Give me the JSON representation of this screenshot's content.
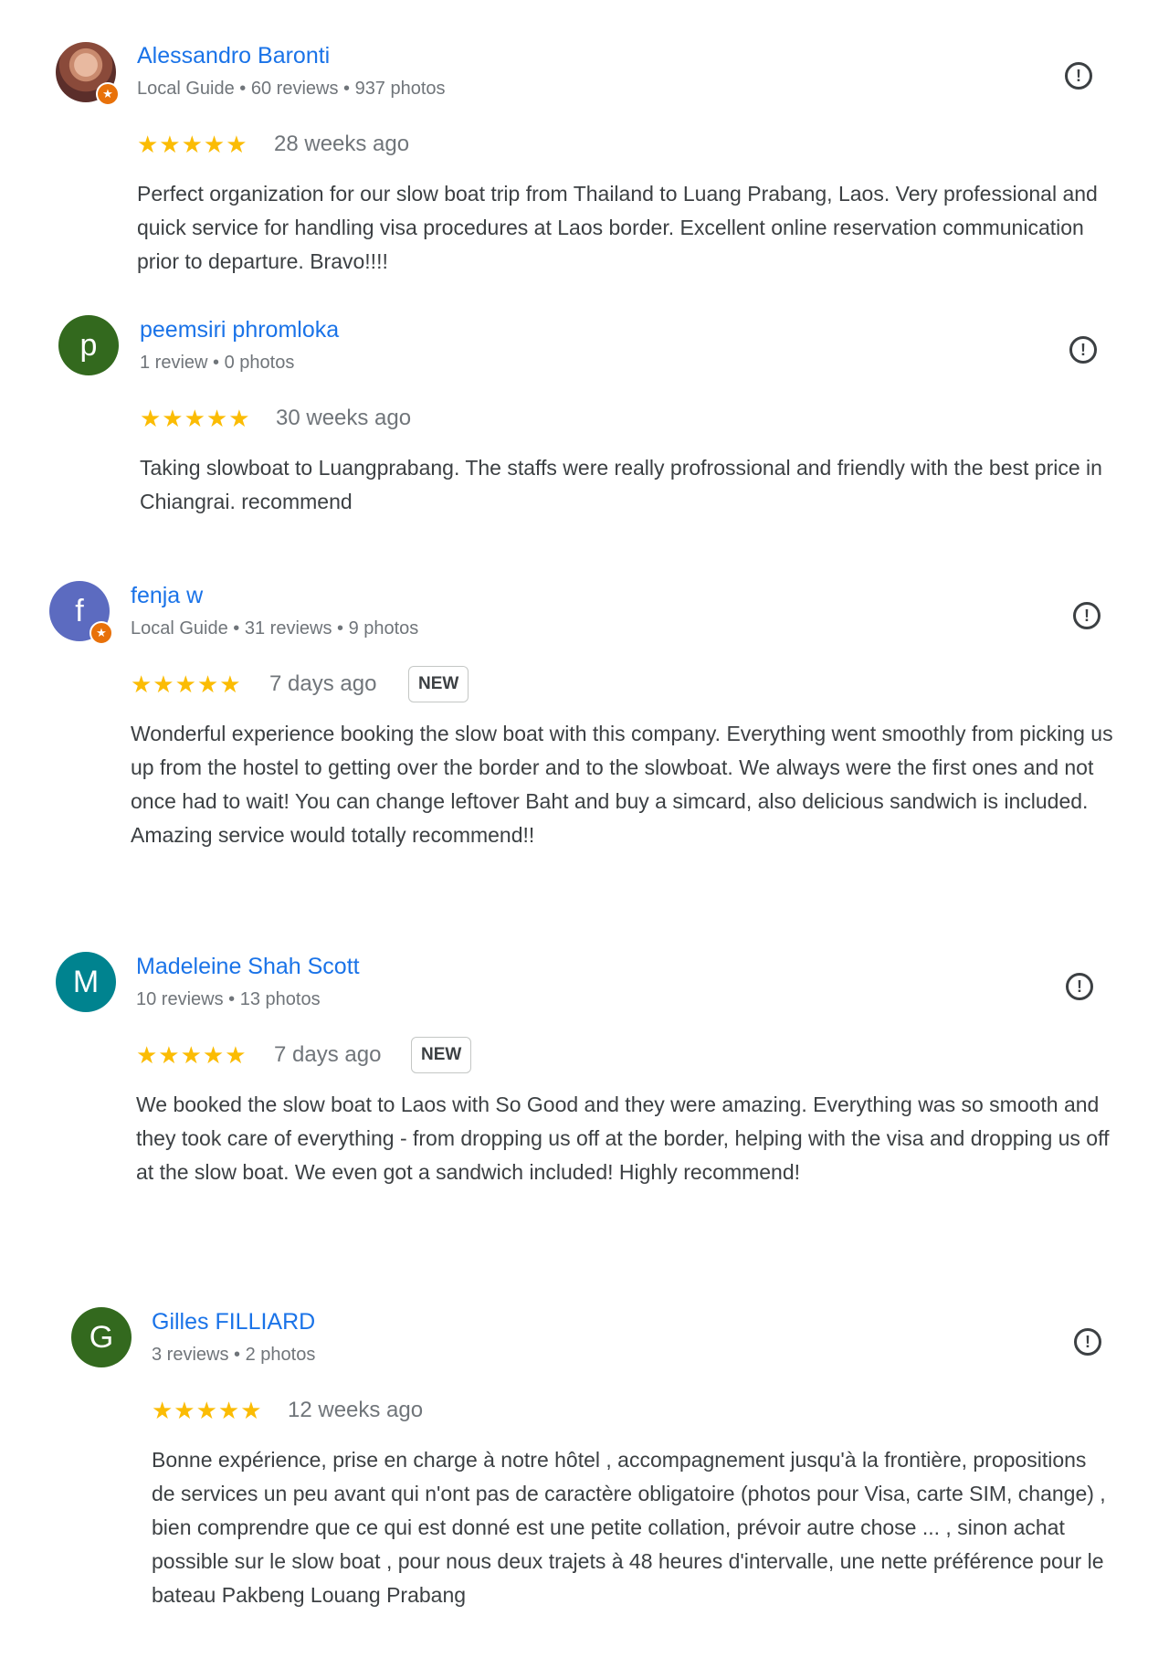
{
  "colors": {
    "link": "#1a73e8",
    "star": "#fbbc04",
    "meta": "#70757a",
    "badge": "#e8710a"
  },
  "icons": {
    "report": "report-flag-icon",
    "local_guide": "local-guide-badge-icon"
  },
  "reviews": [
    {
      "author": "Alessandro Baronti",
      "meta": "Local Guide • 60 reviews • 937 photos",
      "avatar_letter": "",
      "avatar_color": "",
      "local_guide": true,
      "rating": 5,
      "stars": "★★★★★",
      "date": "28 weeks ago",
      "new_label": "",
      "text": "Perfect organization for our slow boat trip from Thailand to Luang Prabang, Laos. Very professional and quick service for handling visa procedures at Laos border. Excellent online reservation communication prior to departure. Bravo!!!!"
    },
    {
      "author": "peemsiri phromloka",
      "meta": "1 review • 0 photos",
      "avatar_letter": "p",
      "avatar_color": "#33691e",
      "local_guide": false,
      "rating": 5,
      "stars": "★★★★★",
      "date": "30 weeks ago",
      "new_label": "",
      "text": "Taking slowboat to Luangprabang. The staffs were really profrossional and friendly with the best price in Chiangrai. recommend"
    },
    {
      "author": "fenja w",
      "meta": "Local Guide • 31 reviews • 9 photos",
      "avatar_letter": "f",
      "avatar_color": "#5c6bc0",
      "local_guide": true,
      "rating": 5,
      "stars": "★★★★★",
      "date": "7 days ago",
      "new_label": "NEW",
      "text": "Wonderful experience booking the slow boat with this company. Everything went smoothly from picking us up from the hostel to getting over the border and to the slowboat. We always were the first ones and not once had to wait! You can change leftover Baht and buy a simcard, also delicious sandwich is included. Amazing service would totally recommend!!"
    },
    {
      "author": "Madeleine Shah Scott",
      "meta": "10 reviews • 13 photos",
      "avatar_letter": "M",
      "avatar_color": "#00838f",
      "local_guide": false,
      "rating": 5,
      "stars": "★★★★★",
      "date": "7 days ago",
      "new_label": "NEW",
      "text": "We booked the slow boat to Laos with So Good and they were amazing. Everything was so smooth and they took care of everything - from dropping us off at the border, helping with the visa and dropping us off at the slow boat. We even got a sandwich included! Highly recommend!"
    },
    {
      "author": "Gilles FILLIARD",
      "meta": "3 reviews • 2 photos",
      "avatar_letter": "G",
      "avatar_color": "#33691e",
      "local_guide": false,
      "rating": 5,
      "stars": "★★★★★",
      "date": "12 weeks ago",
      "new_label": "",
      "text": "Bonne expérience, prise en charge à notre hôtel , accompagnement jusqu'à la frontière, propositions de services un peu avant qui n'ont pas de caractère obligatoire (photos pour Visa, carte SIM, change) , bien comprendre que ce qui est donné est une petite collation, prévoir autre chose ... , sinon achat possible sur le slow boat , pour nous deux trajets à 48 heures d'intervalle, une nette préférence pour le bateau Pakbeng Louang Prabang"
    }
  ]
}
